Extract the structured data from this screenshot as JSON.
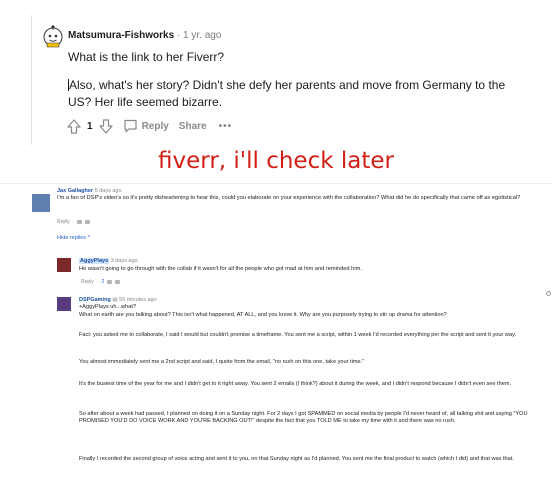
{
  "reddit": {
    "username": "Matsumura-Fishworks",
    "separator": "·",
    "time": "1 yr. ago",
    "paragraph1": "What is the link to her Fiverr?",
    "paragraph2": "Also, what's her story? Didn't she defy her parents and move from Germany to the US? Her life seemed bizarre.",
    "score": "1",
    "reply_label": "Reply",
    "share_label": "Share",
    "more_label": "•••",
    "colors": {
      "accent": "#d93a00",
      "muted": "#878a8c"
    }
  },
  "annotation": {
    "text": "fiverr, i'll check later",
    "color": "#d11f15"
  },
  "youtube": {
    "comment1": {
      "author": "Jax Gallagher",
      "time": "5 days ago",
      "text": "I'm a fan of DSP's video's so it's pretty disheartening to hear this, could you elaborate on your experience with the collaboration? What did he do specifically that came off as egotistical?",
      "reply_label": "Reply",
      "separator": "·"
    },
    "hide_replies": "Hide replies ^",
    "reply1": {
      "author": "AggyPlays",
      "time": "3 days ago",
      "text": "He wasn't going to go through with the collab if it wasn't for all the people who got mad at him and reminded him.",
      "reply_label": "Reply",
      "separator": "·",
      "likes": "2"
    },
    "reply2": {
      "author": "DSPGaming",
      "badge": "▤",
      "time": "50 minutes ago",
      "mention": "+AggyPlays uh...what?",
      "paragraphs": [
        "What on earth are you talking about? This isn't what happened, AT ALL, and you know it. Why are you purposely trying to stir up drama for attention?",
        "Fact: you asked me to collaborate, I said I would but couldn't promise a timeframe. You sent me a script, within 1 week I'd recorded everything per the script and sent it your way.",
        "You almost immediately sent me a 2nd script and said, I quote from the email, \"no rush on this one, take your time.\"",
        "It's the busiest time of the year for me and I didn't get to it right away. You sent 2 emails (I think?) about it during the week, and I didn't respond because I didn't even see them.",
        "So after about a week had passed, I planned on doing it on a Sunday night. For 2 days I got SPAMMED on social media by people I'd never heard of, all talking shit and saying \"YOU PROMISED YOU'D DO VOICE WORK AND YOU'RE BACKING OUT!\" despite the fact that you TOLD ME to take my time with it and there was no rush.",
        "Finally I recorded the second group of voice acting and sent it to you, on that Sunday night as I'd planned. You sent me the final product to watch (which I did) and that was that."
      ]
    }
  }
}
